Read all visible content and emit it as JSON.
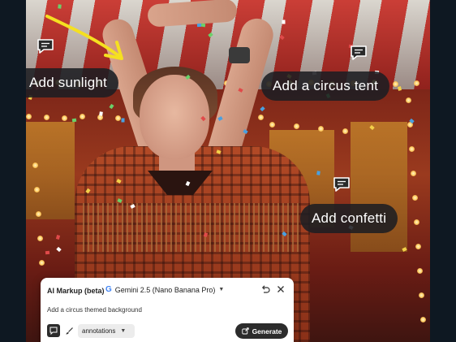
{
  "annotations": {
    "sunlight": "Add sunlight",
    "circus_tent": "Add a circus tent",
    "confetti": "Add confetti"
  },
  "panel": {
    "title": "AI Markup (beta)",
    "model_logo": "G",
    "model_name": "Gemini 2.5 (Nano Banana Pro)",
    "prompt_text": "Add a circus themed background",
    "mode_select": "annotations",
    "generate_label": "Generate"
  },
  "icons": {
    "comment": "comment-icon",
    "arrow": "arrow-annotation",
    "undo": "undo-icon",
    "close": "close-icon",
    "annotate_tool": "annotate-tool-icon",
    "brush_tool": "brush-icon",
    "chevron": "chevron-down-icon",
    "generate": "generate-icon"
  },
  "colors": {
    "arrow": "#f5e020",
    "callout_bg": "#1c1e22",
    "button_dark": "#2c2c2c"
  }
}
